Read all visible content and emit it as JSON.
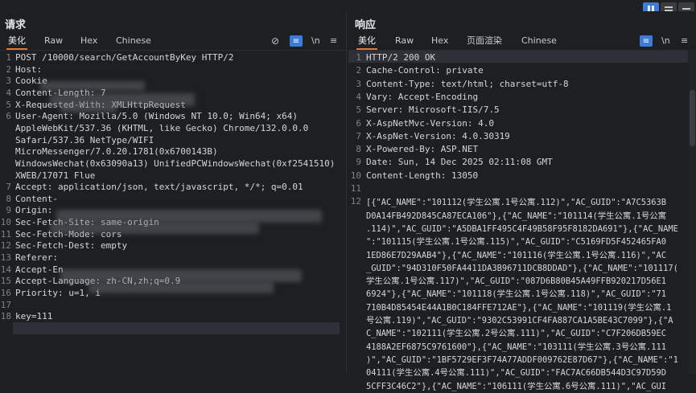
{
  "window": {
    "view_modes": [
      "split-columns",
      "split-rows",
      "single"
    ]
  },
  "request": {
    "title": "请求",
    "tabs": [
      "美化",
      "Raw",
      "Hex",
      "Chinese"
    ],
    "active_tab": "美化",
    "tools": {
      "hide": "⊘",
      "wrap": "≡",
      "newline": "\\n",
      "menu": "≡"
    },
    "lines": [
      {
        "n": "1",
        "text": "POST /10000/search/GetAccountByKey HTTP/2"
      },
      {
        "n": "2",
        "text": "Host:"
      },
      {
        "n": "3",
        "text": "Cookie"
      },
      {
        "n": "4",
        "text": "Content-Length: 7"
      },
      {
        "n": "5",
        "text": "X-Requested-With: XMLHttpRequest"
      },
      {
        "n": "6",
        "text": "User-Agent: Mozilla/5.0 (Windows NT 10.0; Win64; x64)"
      },
      {
        "n": "",
        "text": "AppleWebKit/537.36 (KHTML, like Gecko) Chrome/132.0.0.0"
      },
      {
        "n": "",
        "text": "Safari/537.36 NetType/WIFI"
      },
      {
        "n": "",
        "text": "MicroMessenger/7.0.20.1781(0x6700143B)"
      },
      {
        "n": "",
        "text": "WindowsWechat(0x63090a13) UnifiedPCWindowsWechat(0xf2541510)"
      },
      {
        "n": "",
        "text": "XWEB/17071 Flue"
      },
      {
        "n": "7",
        "text": "Accept: application/json, text/javascript, */*; q=0.01"
      },
      {
        "n": "8",
        "text": "Content-"
      },
      {
        "n": "9",
        "text": "Origin:"
      },
      {
        "n": "10",
        "text": "Sec-Fetch-Site: same-origin"
      },
      {
        "n": "11",
        "text": "Sec-Fetch-Mode: cors"
      },
      {
        "n": "12",
        "text": "Sec-Fetch-Dest: empty"
      },
      {
        "n": "13",
        "text": "Referer:"
      },
      {
        "n": "14",
        "text": "Accept-En"
      },
      {
        "n": "15",
        "text": "Accept-Language: zh-CN,zh;q=0.9"
      },
      {
        "n": "16",
        "text": "Priority: u=1, i"
      },
      {
        "n": "17",
        "text": ""
      },
      {
        "n": "18",
        "text": "key=111"
      }
    ]
  },
  "response": {
    "title": "响应",
    "tabs": [
      "美化",
      "Raw",
      "Hex",
      "页面渲染",
      "Chinese"
    ],
    "active_tab": "美化",
    "tools": {
      "wrap": "≡",
      "newline": "\\n",
      "menu": "≡"
    },
    "lines": [
      {
        "n": "1",
        "text": "HTTP/2 200 OK"
      },
      {
        "n": "2",
        "text": "Cache-Control: private"
      },
      {
        "n": "3",
        "text": "Content-Type: text/html; charset=utf-8"
      },
      {
        "n": "4",
        "text": "Vary: Accept-Encoding"
      },
      {
        "n": "5",
        "text": "Server: Microsoft-IIS/7.5"
      },
      {
        "n": "6",
        "text": "X-AspNetMvc-Version: 4.0"
      },
      {
        "n": "7",
        "text": "X-AspNet-Version: 4.0.30319"
      },
      {
        "n": "8",
        "text": "X-Powered-By: ASP.NET"
      },
      {
        "n": "9",
        "text": "Date: Sun, 14 Dec 2025 02:11:08 GMT"
      },
      {
        "n": "10",
        "text": "Content-Length: 13050"
      },
      {
        "n": "11",
        "text": ""
      },
      {
        "n": "12",
        "text": ""
      }
    ],
    "body_lines": [
      "[{\"AC_NAME\":\"101112(学生公寓.1号公寓.112)\",\"AC_GUID\":\"A7C5363B",
      "D0A14FB492D845CA87ECA106\"},{\"AC_NAME\":\"101114(学生公寓.1号公寓",
      ".114)\",\"AC_GUID\":\"A5DBA1FF495C4F49B58F95F8182DA691\"},{\"AC_NAME",
      "\":\"101115(学生公寓.1号公寓.115)\",\"AC_GUID\":\"C5169FD5F452465FA0",
      "1ED86E7D29AAB4\"},{\"AC_NAME\":\"101116(学生公寓.1号公寓.116)\",\"AC",
      "_GUID\":\"94D310F50FA4411DA3B96711DCB8DDAD\"},{\"AC_NAME\":\"101117(",
      "学生公寓.1号公寓.117)\",\"AC_GUID\":\"087D6B80B45A49FFB920217D56E1",
      "6924\"},{\"AC_NAME\":\"101118(学生公寓.1号公寓.118)\",\"AC_GUID\":\"71",
      "710B4D85454E44A1B0C184FFE712AE\"},{\"AC_NAME\":\"101119(学生公寓.1",
      "号公寓.119)\",\"AC_GUID\":\"9302C53991CF4FA887CA1A5BE43C7099\"},{\"A",
      "C_NAME\":\"102111(学生公寓.2号公寓.111)\",\"AC_GUID\":\"C7F206DB59EC",
      "4188A2EF6875C9761600\"},{\"AC_NAME\":\"103111(学生公寓.3号公寓.111",
      ")\",\"AC_GUID\":\"1BF5729EF3F74A77ADDF009762E87D67\"},{\"AC_NAME\":\"1",
      "04111(学生公寓.4号公寓.111)\",\"AC_GUID\":\"FAC7AC66DB544D3C97D59D",
      "5CFF3C46C2\"},{\"AC_NAME\":\"106111(学生公寓.6号公寓.111)\",\"AC_GUI"
    ]
  }
}
